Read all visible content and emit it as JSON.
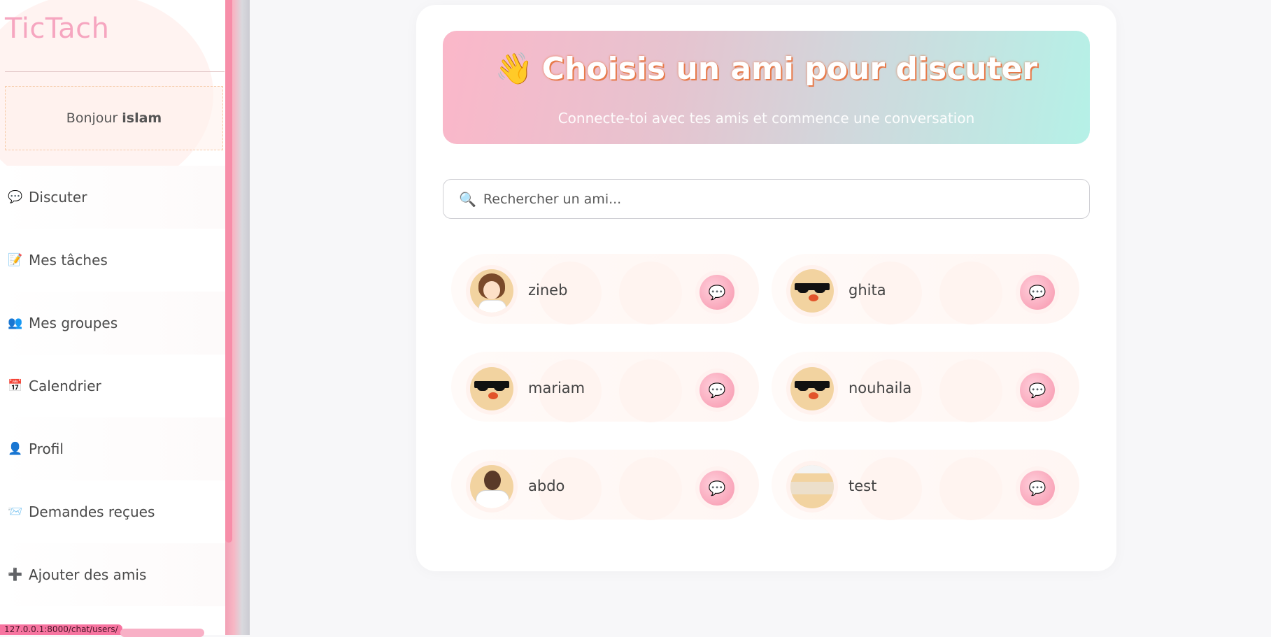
{
  "sidebar": {
    "logo": "TicTach",
    "greeting_prefix": "Bonjour",
    "username": "islam",
    "items": [
      {
        "label": "Discuter",
        "icon": "speech-bubble-icon",
        "glyph": "💬"
      },
      {
        "label": "Mes tâches",
        "icon": "memo-icon",
        "glyph": "📝"
      },
      {
        "label": "Mes groupes",
        "icon": "people-icon",
        "glyph": "👥"
      },
      {
        "label": "Calendrier",
        "icon": "calendar-icon",
        "glyph": "📅"
      },
      {
        "label": "Profil",
        "icon": "user-icon",
        "glyph": "👤"
      },
      {
        "label": "Demandes reçues",
        "icon": "envelope-icon",
        "glyph": "📨"
      },
      {
        "label": "Ajouter des amis",
        "icon": "plus-icon",
        "glyph": "➕"
      }
    ]
  },
  "status_bar": {
    "url": "127.0.0.1:8000/chat/users/"
  },
  "main": {
    "hero": {
      "wave_glyph": "👋",
      "title": "Choisis un ami pour discuter",
      "subtitle": "Connecte-toi avec tes amis et commence une conversation"
    },
    "search": {
      "icon_glyph": "🔍",
      "placeholder": "Rechercher un ami..."
    },
    "friends": [
      {
        "name": "zineb",
        "avatar": "anime-girl-doctor"
      },
      {
        "name": "ghita",
        "avatar": "duck-with-sunglasses"
      },
      {
        "name": "mariam",
        "avatar": "duck-with-sunglasses"
      },
      {
        "name": "nouhaila",
        "avatar": "duck-with-sunglasses"
      },
      {
        "name": "abdo",
        "avatar": "doctor-photo"
      },
      {
        "name": "test",
        "avatar": "gray-screenshot"
      }
    ],
    "chat_button_glyph": "💬"
  },
  "colors": {
    "brand_pink": "#f6a6c0",
    "hero_start": "#fbb7c9",
    "hero_end": "#b5f1e7",
    "title_outline": "#e77a4a",
    "chat_button": "#f9a6ba"
  }
}
